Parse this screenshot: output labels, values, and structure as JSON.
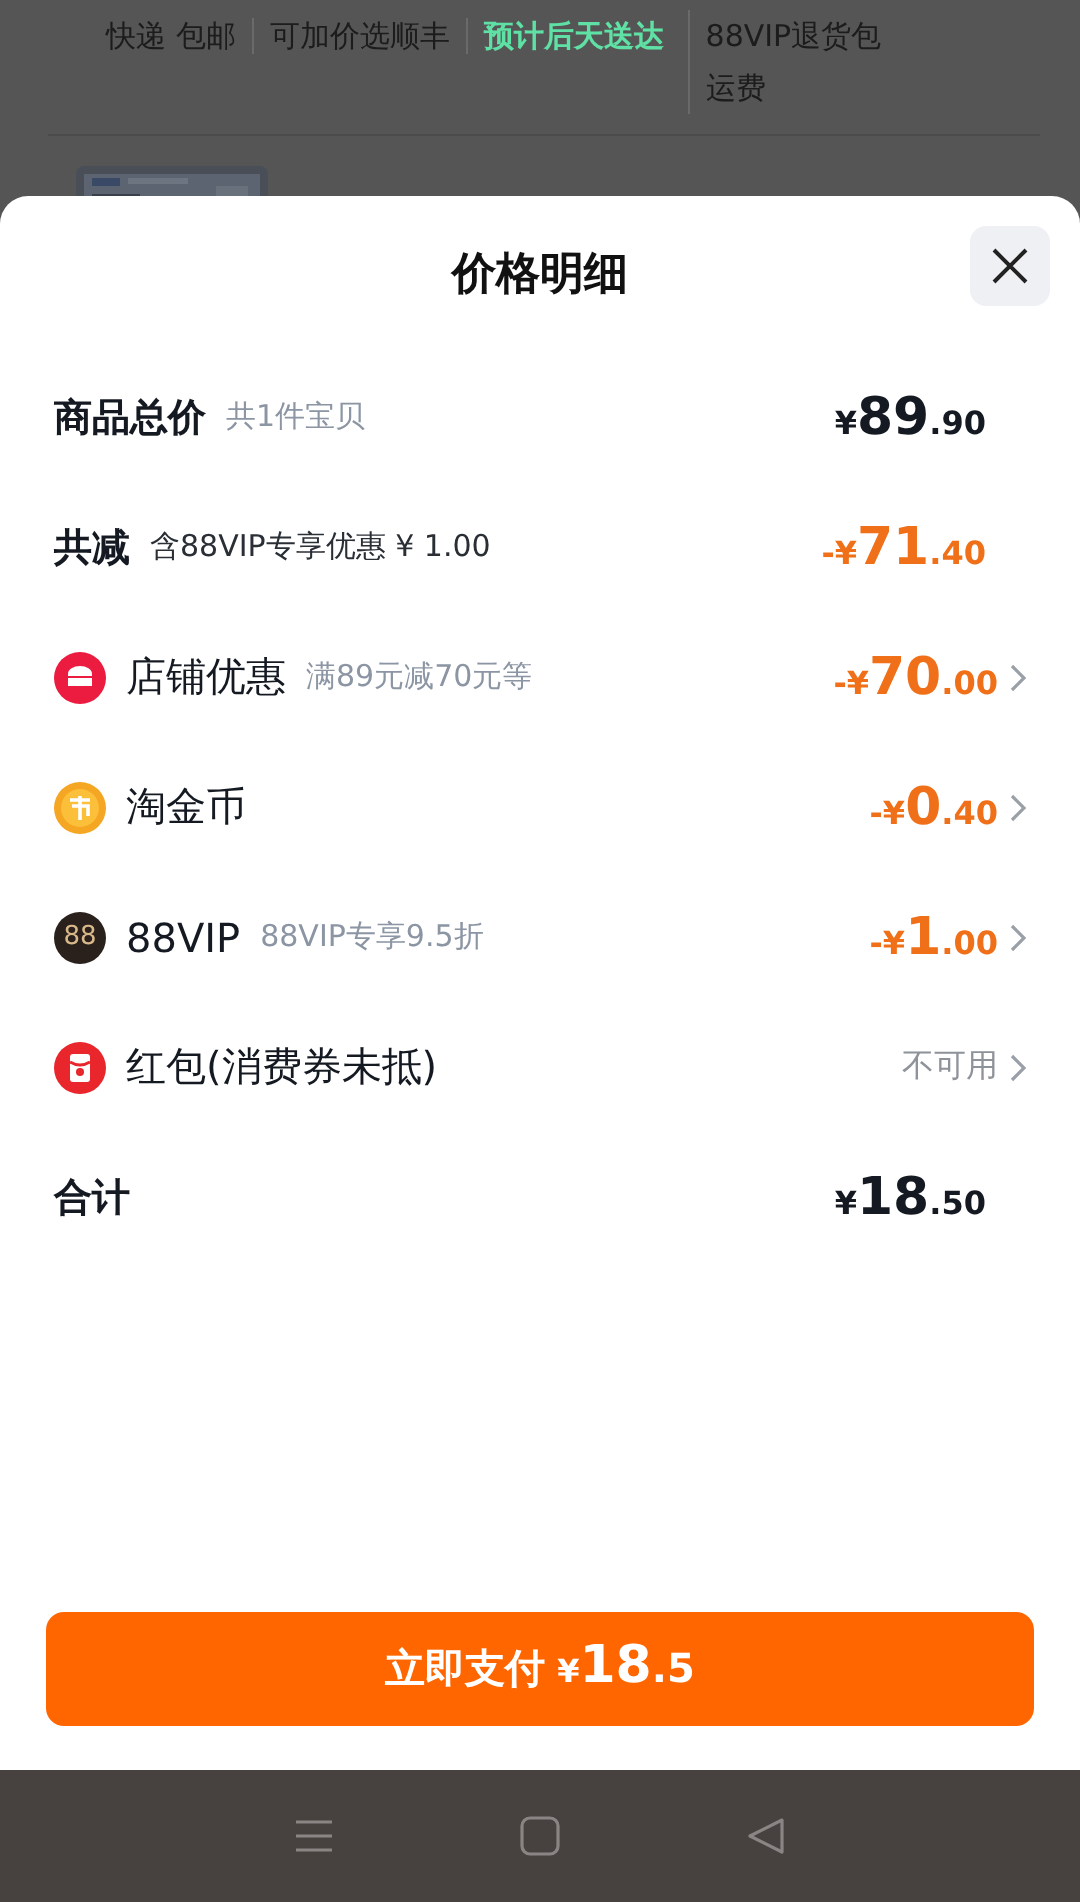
{
  "background": {
    "shipping_tags": [
      {
        "text": "快递 包邮",
        "highlight": false
      },
      {
        "text": "可加价选顺丰",
        "highlight": false
      },
      {
        "text": "预计后天送达",
        "highlight": true
      },
      {
        "text": "88VIP退货包运费",
        "highlight": false
      }
    ]
  },
  "sheet": {
    "title": "价格明细"
  },
  "rows": [
    {
      "kind": "subtotal",
      "label": "商品总价",
      "note": "共1件宝贝",
      "amount": {
        "currency": "¥",
        "whole": "89",
        "fraction": ".90"
      }
    },
    {
      "kind": "deduction",
      "label": "共减",
      "note": "含88VIP专享优惠 ¥ 1.00",
      "amount": {
        "sign": "-",
        "currency": "¥",
        "whole": "71",
        "fraction": ".40"
      }
    },
    {
      "kind": "discount",
      "label": "店铺优惠",
      "note": "满89元减70元等",
      "amount": {
        "sign": "-",
        "currency": "¥",
        "whole": "70",
        "fraction": ".00"
      }
    },
    {
      "kind": "discount",
      "label": "淘金币",
      "amount": {
        "sign": "-",
        "currency": "¥",
        "whole": "0",
        "fraction": ".40"
      }
    },
    {
      "kind": "discount",
      "badge": "88",
      "label": "88VIP",
      "note": "88VIP专享9.5折",
      "amount": {
        "sign": "-",
        "currency": "¥",
        "whole": "1",
        "fraction": ".00"
      }
    },
    {
      "kind": "discount",
      "label": "红包(消费券未抵)",
      "status": "不可用"
    },
    {
      "kind": "total",
      "label": "合计",
      "amount": {
        "currency": "¥",
        "whole": "18",
        "fraction": ".50"
      }
    }
  ],
  "pay_button": {
    "label": "立即支付",
    "currency": "¥",
    "whole": "18",
    "fraction": ".5"
  }
}
